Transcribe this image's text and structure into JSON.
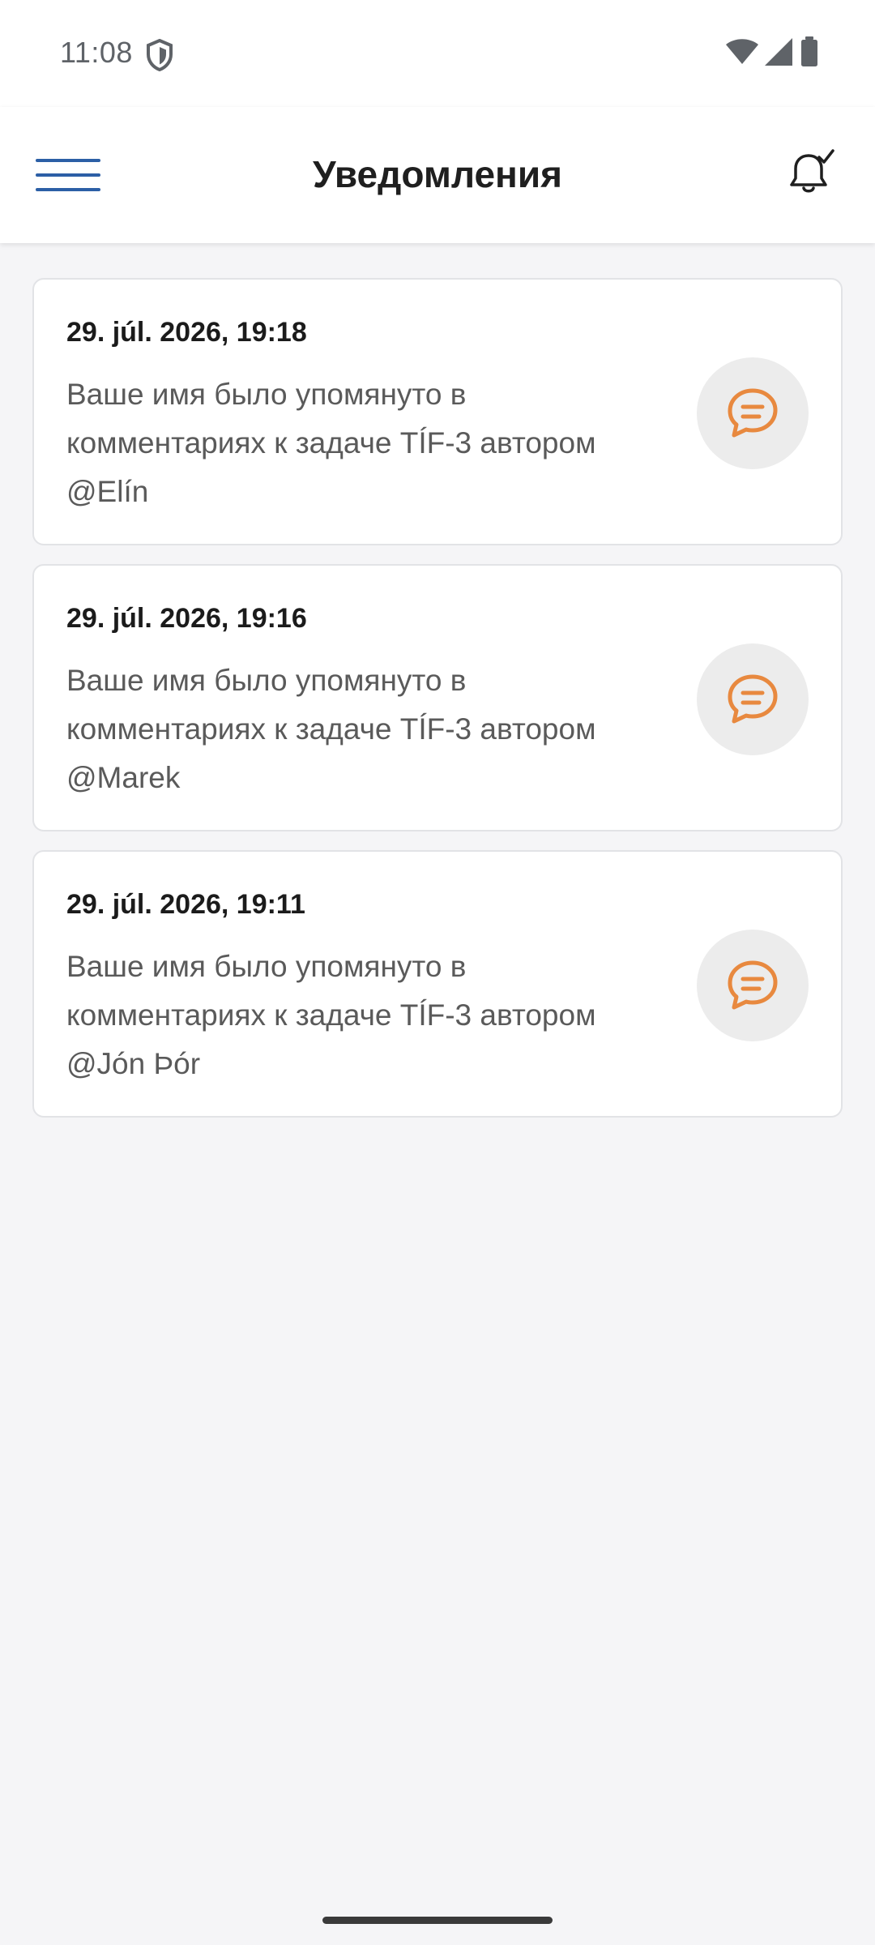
{
  "status_bar": {
    "time": "11:08",
    "shield_icon": "shield-icon",
    "wifi_icon": "wifi-icon",
    "signal_icon": "signal-icon",
    "battery_icon": "battery-icon"
  },
  "app_bar": {
    "title": "Уведомления",
    "menu_icon": "menu-icon",
    "mark_all_read_icon": "bell-check-icon",
    "accent_color": "#2c5fa6"
  },
  "notifications": [
    {
      "date": "29. júl. 2026, 19:18",
      "text": "Ваше имя было упомянуто в\nкомментариях к задаче TÍF-3 автором\n@Elín",
      "icon": "comment-icon"
    },
    {
      "date": "29. júl. 2026, 19:16",
      "text": "Ваше имя было упомянуто в\nкомментариях к задаче TÍF-3 автором\n@Marek",
      "icon": "comment-icon"
    },
    {
      "date": "29. júl. 2026, 19:11",
      "text": "Ваше имя было упомянуто в\nкомментариях к задаче TÍF-3 автором\n@Jón Þór",
      "icon": "comment-icon"
    }
  ],
  "colors": {
    "icon_accent": "#e8893f",
    "background": "#f5f5f7"
  }
}
